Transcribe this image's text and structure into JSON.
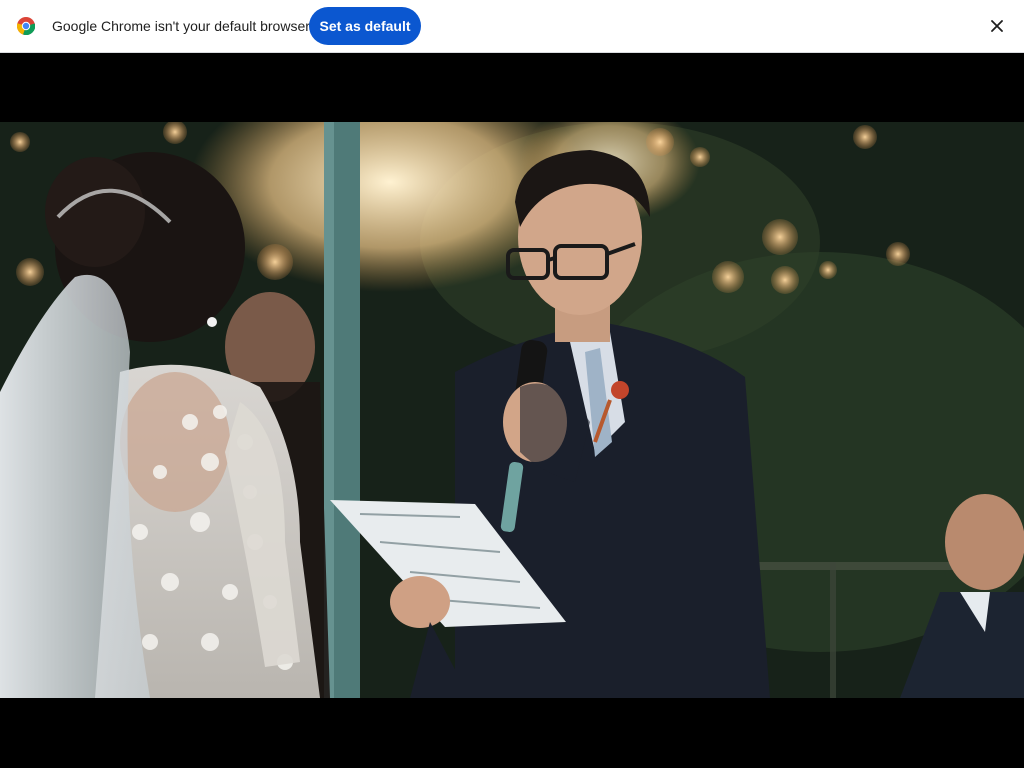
{
  "infobar": {
    "message": "Google Chrome isn't your default browser",
    "button_label": "Set as default",
    "close_icon": "close-icon",
    "logo_icon": "chrome-logo-icon"
  },
  "video": {
    "scene": "wedding-ceremony-still"
  },
  "colors": {
    "infobar_bg": "#ffffff",
    "button_bg": "#0b57d0",
    "button_text": "#ffffff",
    "letterbox": "#000000"
  }
}
